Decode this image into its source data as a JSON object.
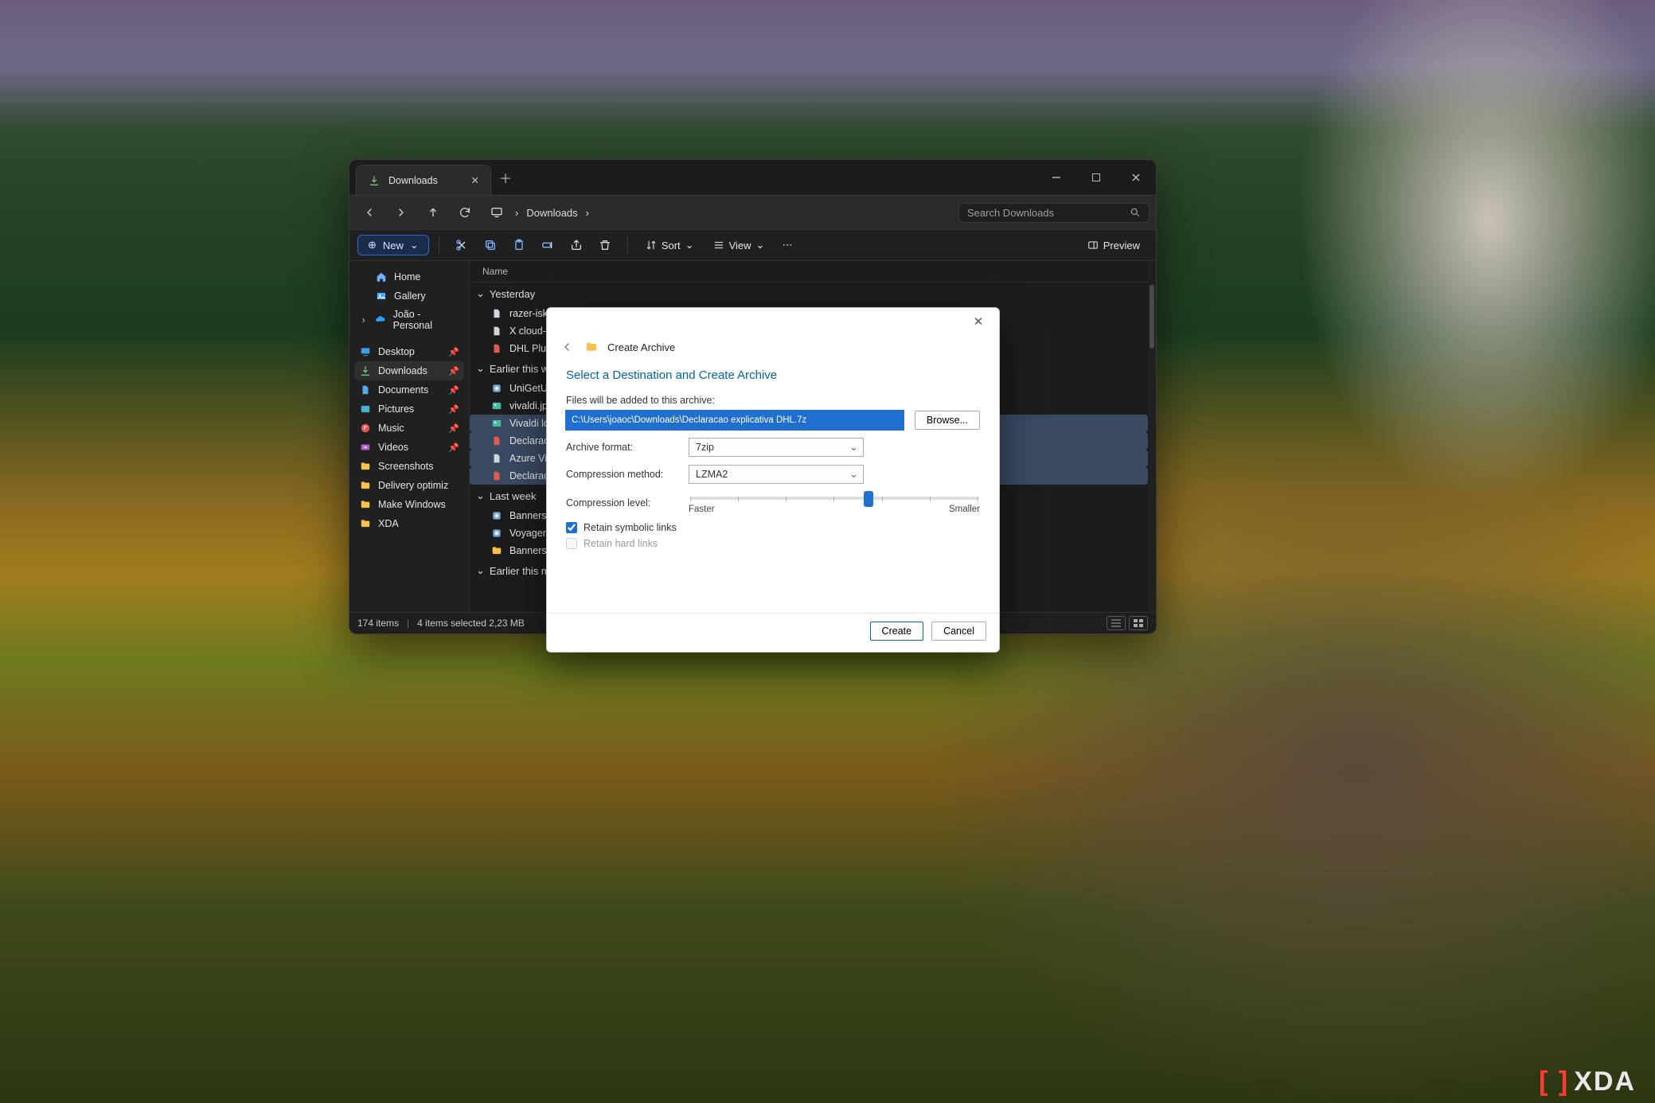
{
  "explorer": {
    "tab_title": "Downloads",
    "breadcrumb": "Downloads",
    "search_placeholder": "Search Downloads",
    "toolbar": {
      "new": "New",
      "sort": "Sort",
      "view": "View",
      "preview": "Preview"
    },
    "sidebar": {
      "top": [
        {
          "icon": "home",
          "label": "Home"
        },
        {
          "icon": "gallery",
          "label": "Gallery"
        },
        {
          "icon": "onedrive",
          "label": "João - Personal",
          "expandable": true
        }
      ],
      "quick": [
        {
          "icon": "desktop",
          "label": "Desktop",
          "pinned": true
        },
        {
          "icon": "downloads",
          "label": "Downloads",
          "pinned": true,
          "active": true
        },
        {
          "icon": "documents",
          "label": "Documents",
          "pinned": true
        },
        {
          "icon": "pictures",
          "label": "Pictures",
          "pinned": true
        },
        {
          "icon": "music",
          "label": "Music",
          "pinned": true
        },
        {
          "icon": "videos",
          "label": "Videos",
          "pinned": true
        },
        {
          "icon": "folder",
          "label": "Screenshots"
        },
        {
          "icon": "folder",
          "label": "Delivery optimiz"
        },
        {
          "icon": "folder",
          "label": "Make Windows"
        },
        {
          "icon": "folder",
          "label": "XDA"
        }
      ]
    },
    "columns": {
      "name": "Name"
    },
    "groups": [
      {
        "title": "Yesterday",
        "rows": [
          {
            "icon": "file",
            "label": "razer-iskur-v2-g"
          },
          {
            "icon": "file",
            "label": "X cloud-based v"
          },
          {
            "icon": "pdf",
            "label": "DHL Plugable co"
          }
        ]
      },
      {
        "title": "Earlier this week",
        "rows": [
          {
            "icon": "exe",
            "label": "UniGetUI.Installe"
          },
          {
            "icon": "image",
            "label": "vivaldi.jpg"
          },
          {
            "icon": "image",
            "label": "Vivaldi login.png",
            "selected": true
          },
          {
            "icon": "pdf",
            "label": "Declaracao expli",
            "selected": true
          },
          {
            "icon": "file",
            "label": "Azure Virtual Des",
            "selected": true
          },
          {
            "icon": "pdf",
            "label": "Declaração Expli",
            "selected": true
          }
        ]
      },
      {
        "title": "Last week",
        "rows": [
          {
            "icon": "exe",
            "label": "Banners new op"
          },
          {
            "icon": "exe",
            "label": "Voyager.exe"
          },
          {
            "icon": "folder",
            "label": "Banners new op"
          }
        ]
      },
      {
        "title": "Earlier this month",
        "rows": []
      }
    ],
    "statusbar": {
      "items": "174 items",
      "selection": "4 items selected  2,23 MB"
    }
  },
  "dialog": {
    "title": "Create Archive",
    "heading": "Select a Destination and Create Archive",
    "note": "Files will be added to this archive:",
    "path": "C:\\Users\\joaoc\\Downloads\\Declaracao explicativa DHL.7z",
    "browse": "Browse...",
    "labels": {
      "format": "Archive format:",
      "method": "Compression method:",
      "level": "Compression level:"
    },
    "format_value": "7zip",
    "method_value": "LZMA2",
    "slider": {
      "pos_percent": 62,
      "left": "Faster",
      "right": "Smaller"
    },
    "checks": {
      "symbolic": "Retain symbolic links",
      "hard": "Retain hard links"
    },
    "buttons": {
      "create": "Create",
      "cancel": "Cancel"
    }
  },
  "branding": {
    "text": "XDA"
  }
}
